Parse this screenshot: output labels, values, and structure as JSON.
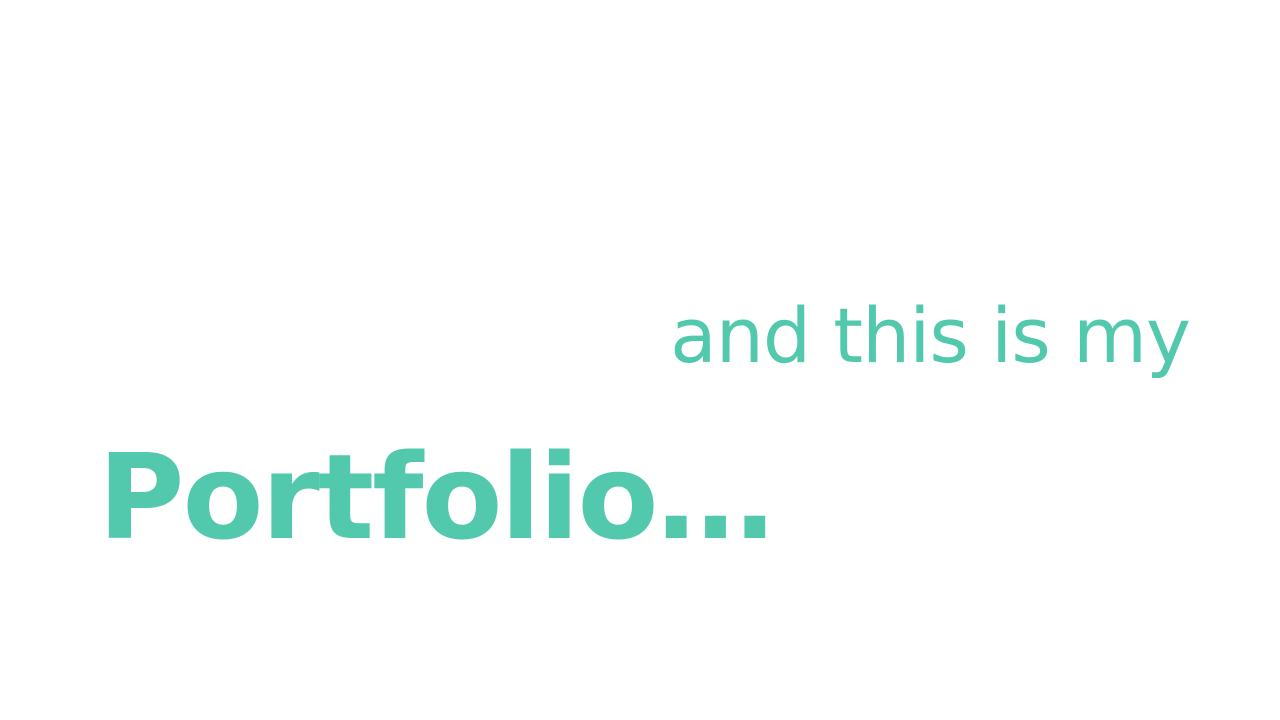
{
  "slide": {
    "subtitle": "and this is my",
    "title": "Portfolio…"
  },
  "colors": {
    "background": "#ffffff",
    "text_accent": "#52c8ac"
  }
}
